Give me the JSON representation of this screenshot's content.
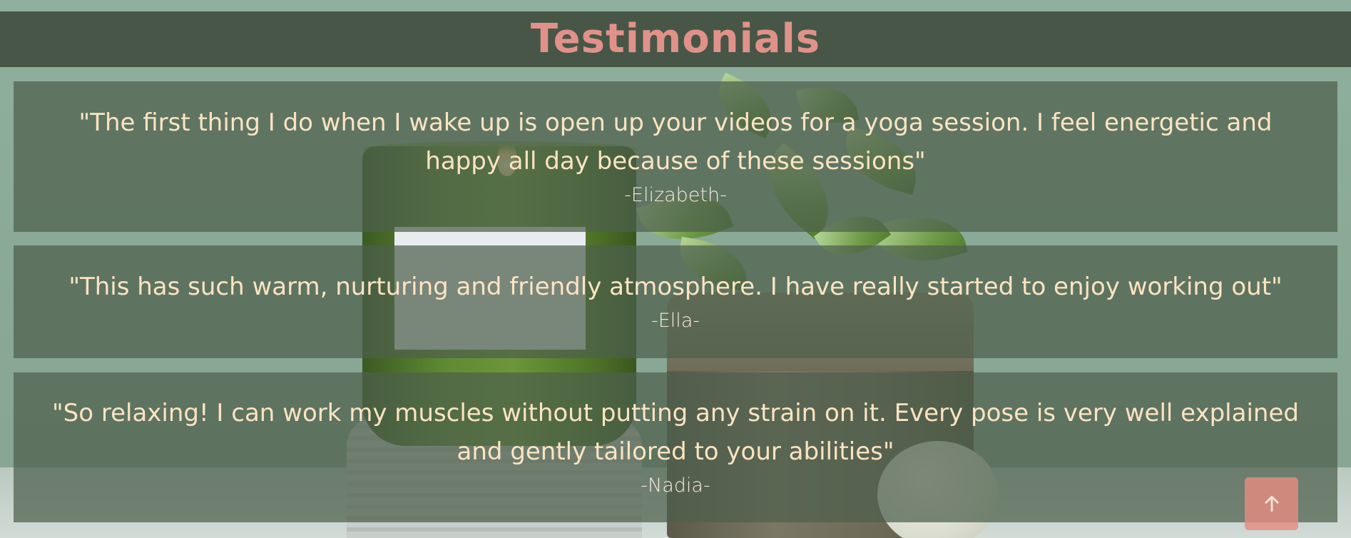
{
  "header": {
    "title": "Testimonials"
  },
  "testimonials": [
    {
      "quote": "\"The first thing I do when I wake up is open up your videos for a yoga session. I feel energetic and happy all day because of these sessions\"",
      "author": "-Elizabeth-"
    },
    {
      "quote": "\"This has such warm, nurturing and friendly atmosphere. I have really started to enjoy working out\"",
      "author": "-Ella-"
    },
    {
      "quote": "\"So relaxing! I can work my muscles without putting any strain on it. Every pose is very well explained and gently tailored to your abilities\"",
      "author": "-Nadia-"
    }
  ],
  "scroll_top_button": {
    "icon": "arrow-up-icon"
  },
  "colors": {
    "title": "#e0928a",
    "quote_text": "#fbe4c2",
    "author_text": "#f7ebde",
    "header_bg": "#3d4a3a",
    "card_bg": "#4e604c",
    "button_bg": "#e48c80"
  }
}
